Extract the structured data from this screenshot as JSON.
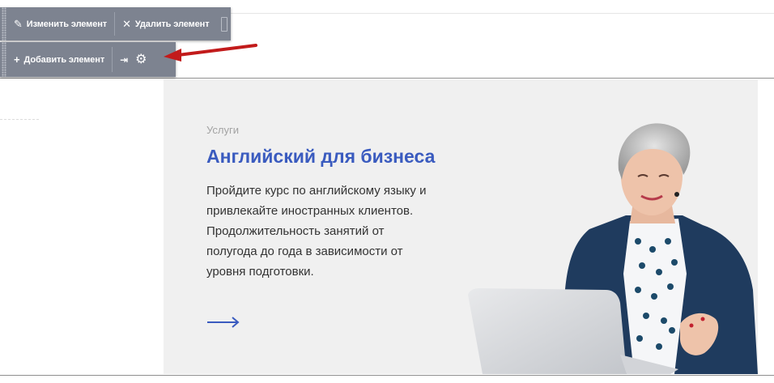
{
  "toolbar_top": {
    "edit_label": "Изменить элемент",
    "delete_label": "Удалить элемент"
  },
  "toolbar_bottom": {
    "add_label": "Добавить элемент"
  },
  "hero": {
    "eyebrow": "Услуги",
    "title": "Английский для бизнеса",
    "description_lines": [
      "Пройдите курс по английскому языку и",
      "привлекайте иностранных клиентов.",
      "Продолжительность занятий от",
      "полугода до года в зависимости от",
      "уровня подготовки."
    ]
  },
  "icons": {
    "edit": "pencil-icon",
    "delete": "close-icon",
    "add": "plus-icon",
    "pin": "pin-icon",
    "settings": "gear-icon",
    "more": "arrow-right-icon"
  },
  "colors": {
    "toolbar_bg": "#7d8390",
    "title": "#3a5bbf",
    "hero_bg": "#f0f0f0",
    "annotation_arrow": "#c21b1b"
  }
}
